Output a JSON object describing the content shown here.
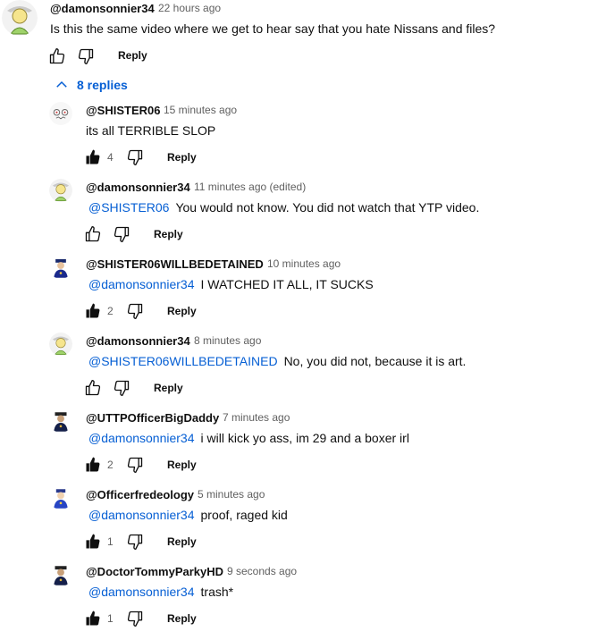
{
  "top_comment": {
    "author": "@damonsonnier34",
    "time": "22 hours ago",
    "text": "Is this the same video where we get to hear say that you hate Nissans and files?",
    "reply_label": "Reply"
  },
  "replies_toggle": {
    "label": "8 replies"
  },
  "replies": [
    {
      "author": "@SHISTER06",
      "time": "15 minutes ago",
      "mention": "",
      "text": "its all TERRIBLE SLOP",
      "likes": "4",
      "liked": true,
      "reply_label": "Reply",
      "avatar": "shister"
    },
    {
      "author": "@damonsonnier34",
      "time": "11 minutes ago (edited)",
      "mention": "@SHISTER06",
      "text": "You would not know. You did not watch that YTP video.",
      "likes": "",
      "liked": false,
      "reply_label": "Reply",
      "avatar": "damon"
    },
    {
      "author": "@SHISTER06WILLBEDETAINED",
      "time": "10 minutes ago",
      "mention": "@damonsonnier34",
      "text": "I WATCHED IT ALL, IT SUCKS",
      "likes": "2",
      "liked": true,
      "reply_label": "Reply",
      "avatar": "police"
    },
    {
      "author": "@damonsonnier34",
      "time": "8 minutes ago",
      "mention": "@SHISTER06WILLBEDETAINED",
      "text": "No, you did not, because it is art.",
      "likes": "",
      "liked": false,
      "reply_label": "Reply",
      "avatar": "damon"
    },
    {
      "author": "@UTTPOfficerBigDaddy",
      "time": "7 minutes ago",
      "mention": "@damonsonnier34",
      "text": "i will kick yo ass, im 29 and a boxer irl",
      "likes": "2",
      "liked": true,
      "reply_label": "Reply",
      "avatar": "officer-dark"
    },
    {
      "author": "@Officerfredeology",
      "time": "5 minutes ago",
      "mention": "@damonsonnier34",
      "text": "proof, raged kid",
      "likes": "1",
      "liked": true,
      "reply_label": "Reply",
      "avatar": "officer-blue"
    },
    {
      "author": "@DoctorTommyParkyHD",
      "time": "9 seconds ago",
      "mention": "@damonsonnier34",
      "text": "trash*",
      "likes": "1",
      "liked": true,
      "reply_label": "Reply",
      "avatar": "officer-dark"
    }
  ]
}
